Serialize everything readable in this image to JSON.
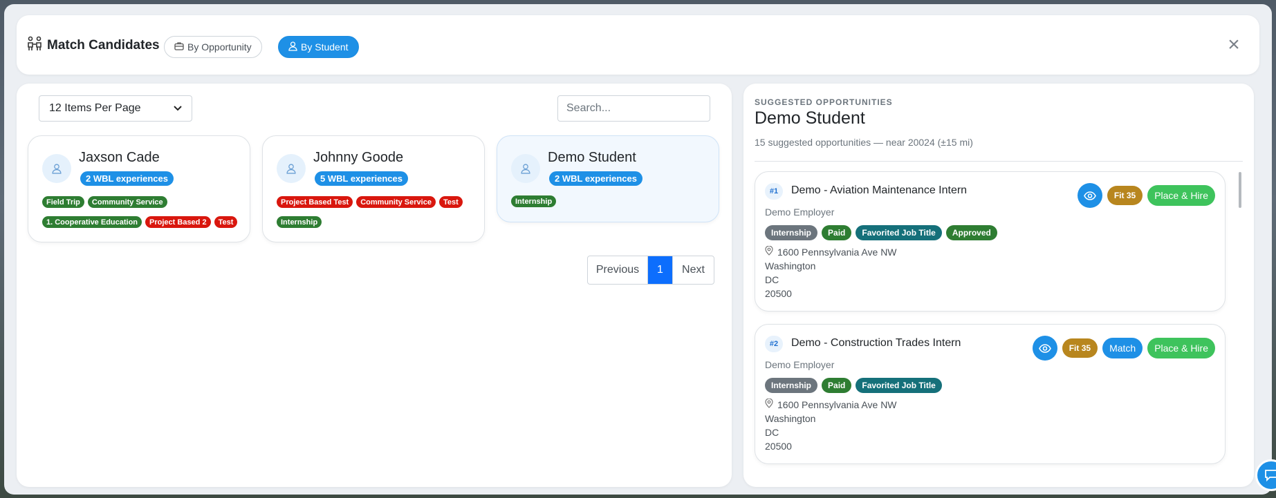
{
  "header": {
    "title": "Match Candidates",
    "by_opportunity_label": "By Opportunity",
    "by_student_label": "By Student",
    "close_label": "×"
  },
  "left": {
    "per_page_value": "12 Items Per Page",
    "search_placeholder": "Search...",
    "students": [
      {
        "name": "Jaxson Cade",
        "wbl_badge": "2 WBL experiences",
        "tag_row1": [
          {
            "label": "Field Trip",
            "color": "green"
          },
          {
            "label": "Community Service",
            "color": "green"
          }
        ],
        "tag_row2": [
          {
            "label": "1. Cooperative Education",
            "color": "green"
          },
          {
            "label": "Project Based 2",
            "color": "red"
          },
          {
            "label": "Test",
            "color": "red"
          }
        ]
      },
      {
        "name": "Johnny Goode",
        "wbl_badge": "5 WBL experiences",
        "tag_row1": [
          {
            "label": "Project Based Test",
            "color": "red"
          },
          {
            "label": "Community Service",
            "color": "red"
          },
          {
            "label": "Test",
            "color": "red"
          }
        ],
        "tag_row2": [
          {
            "label": "Internship",
            "color": "green"
          }
        ]
      },
      {
        "name": "Demo Student",
        "wbl_badge": "2 WBL experiences",
        "tag_row1": [
          {
            "label": "Internship",
            "color": "green"
          }
        ],
        "tag_row2": []
      }
    ],
    "pagination": {
      "previous": "Previous",
      "current": "1",
      "next": "Next"
    }
  },
  "right": {
    "eyebrow": "SUGGESTED OPPORTUNITIES",
    "student_name": "Demo Student",
    "subtitle": "15 suggested opportunities — near 20024 (±15 mi)",
    "opportunities": [
      {
        "rank": "#1",
        "title": "Demo - Aviation Maintenance Intern",
        "employer": "Demo Employer",
        "tags": [
          {
            "label": "Internship",
            "color": "gray"
          },
          {
            "label": "Paid",
            "color": "green"
          },
          {
            "label": "Favorited Job Title",
            "color": "teal"
          },
          {
            "label": "Approved",
            "color": "green"
          }
        ],
        "address": [
          "1600 Pennsylvania Ave NW",
          "Washington",
          "DC",
          "20500"
        ],
        "fit": "Fit 35",
        "match_label": "",
        "hire_label": "Place & Hire"
      },
      {
        "rank": "#2",
        "title": "Demo - Construction Trades Intern",
        "employer": "Demo Employer",
        "tags": [
          {
            "label": "Internship",
            "color": "gray"
          },
          {
            "label": "Paid",
            "color": "green"
          },
          {
            "label": "Favorited Job Title",
            "color": "teal"
          }
        ],
        "address": [
          "1600 Pennsylvania Ave NW",
          "Washington",
          "DC",
          "20500"
        ],
        "fit": "Fit 35",
        "match_label": "Match",
        "hire_label": "Place & Hire"
      }
    ]
  },
  "colors": {
    "primary": "#1e90e6",
    "tag_green": "#2e7d32",
    "tag_red": "#d9170e",
    "tag_gray": "#6c757d",
    "tag_teal": "#15707a",
    "fit": "#b8861e",
    "hire": "#3ec35c"
  }
}
